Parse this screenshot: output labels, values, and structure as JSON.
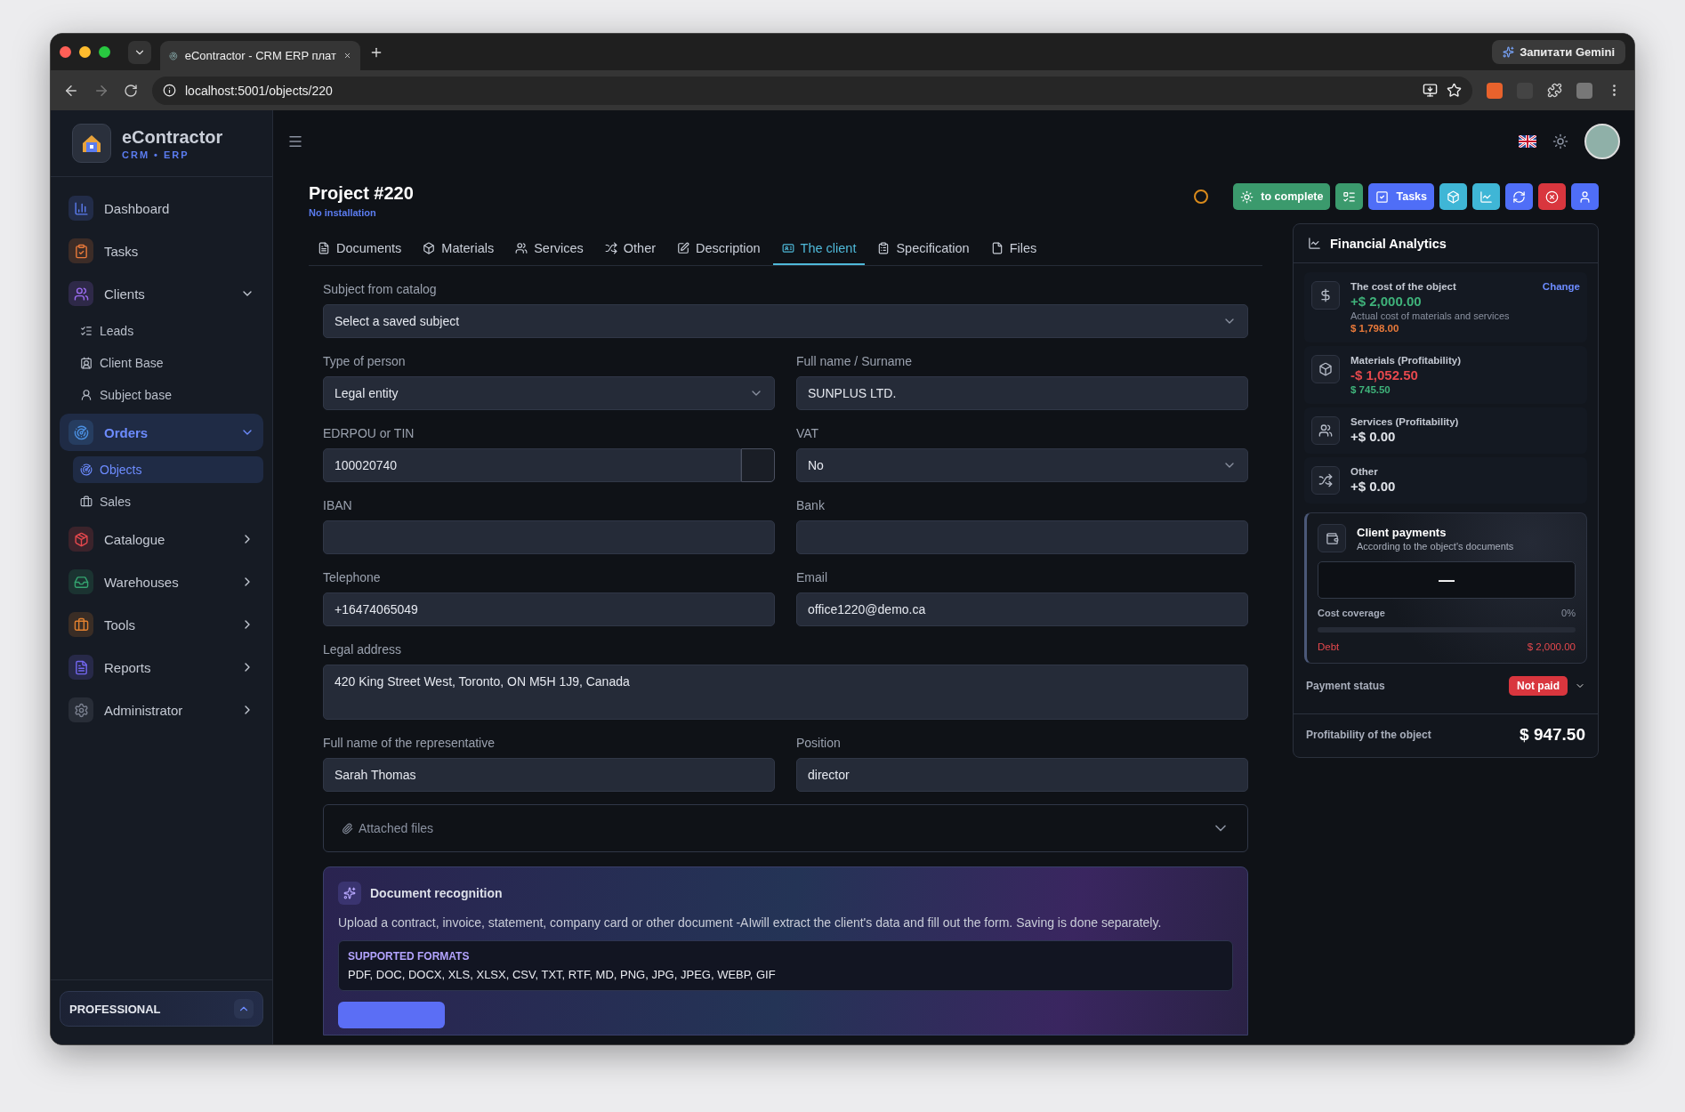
{
  "browser": {
    "tab_title": "eContractor - CRM ERP плат",
    "url": "localhost:5001/objects/220",
    "assistant_button": "Запитати Gemini"
  },
  "sidebar": {
    "brand": "eContractor",
    "brand_sub": "CRM • ERP",
    "items": [
      {
        "label": "Dashboard",
        "selected": false
      },
      {
        "label": "Tasks",
        "selected": false
      },
      {
        "label": "Clients",
        "selected": false,
        "expanded": true,
        "children": [
          {
            "label": "Leads",
            "selected": false
          },
          {
            "label": "Client Base",
            "selected": false
          },
          {
            "label": "Subject base",
            "selected": false
          }
        ]
      },
      {
        "label": "Orders",
        "selected": true,
        "expanded": true,
        "children": [
          {
            "label": "Objects",
            "selected": true
          },
          {
            "label": "Sales",
            "selected": false
          }
        ]
      },
      {
        "label": "Catalogue",
        "selected": false,
        "expanded": false
      },
      {
        "label": "Warehouses",
        "selected": false,
        "expanded": false
      },
      {
        "label": "Tools",
        "selected": false,
        "expanded": false
      },
      {
        "label": "Reports",
        "selected": false,
        "expanded": false
      },
      {
        "label": "Administrator",
        "selected": false,
        "expanded": false
      }
    ],
    "plan": "PROFESSIONAL"
  },
  "header": {
    "title": "Project #220",
    "subtitle": "No installation",
    "actions": [
      {
        "label": "to complete",
        "color": "#3b9a6d"
      },
      {
        "color": "#3b9a6d"
      },
      {
        "label": "Tasks",
        "color": "#4f6ef7"
      },
      {
        "color": "#3fb6d6"
      },
      {
        "color": "#3fb6d6"
      },
      {
        "color": "#4f6ef7"
      },
      {
        "color": "#d9363e"
      },
      {
        "color": "#4f6ef7"
      }
    ]
  },
  "tabs": [
    {
      "label": "Documents",
      "selected": false
    },
    {
      "label": "Materials",
      "selected": false
    },
    {
      "label": "Services",
      "selected": false
    },
    {
      "label": "Other",
      "selected": false
    },
    {
      "label": "Description",
      "selected": false
    },
    {
      "label": "The client",
      "selected": true
    },
    {
      "label": "Specification",
      "selected": false
    },
    {
      "label": "Files",
      "selected": false
    }
  ],
  "form": [
    [
      {
        "label": "Subject from catalog",
        "kind": "select",
        "value": "Select a saved subject"
      }
    ],
    [
      {
        "label": "Type of person",
        "kind": "select",
        "value": "Legal entity"
      },
      {
        "label": "Full name / Surname",
        "kind": "input",
        "value": "SUNPLUS LTD."
      }
    ],
    [
      {
        "label": "EDRPOU or TIN",
        "kind": "input_addon",
        "value": "100020740"
      },
      {
        "label": "VAT",
        "kind": "select",
        "value": "No"
      }
    ],
    [
      {
        "label": "IBAN",
        "kind": "input"
      },
      {
        "label": "Bank",
        "kind": "input"
      }
    ],
    [
      {
        "label": "Telephone",
        "kind": "input",
        "value": "+16474065049"
      },
      {
        "label": "Email",
        "kind": "input",
        "value": "office1220@demo.ca"
      }
    ],
    [
      {
        "label": "Legal address",
        "kind": "textarea",
        "value": "420 King Street West, Toronto, ON M5H 1J9, Canada"
      }
    ],
    [
      {
        "label": "Full name of the representative",
        "kind": "input",
        "value": "Sarah Thomas"
      },
      {
        "label": "Position",
        "kind": "input",
        "value": "director"
      }
    ]
  ],
  "attached_files": {
    "label": "Attached files",
    "expanded": false
  },
  "recognition": {
    "title": "Document recognition",
    "text": "Upload a contract, invoice, statement, company card or other document -AIwill extract the client's data and fill out the form. Saving is done separately.",
    "formats_title": "SUPPORTED FORMATS",
    "formats": "PDF, DOC, DOCX, XLS, XLSX, CSV, TXT, RTF, MD, PNG, JPG, JPEG, WEBP, GIF"
  },
  "analytics": {
    "title": "Financial Analytics",
    "items": [
      {
        "title": "The cost of the object",
        "value": "+$ 2,000.00",
        "color": "#3fb27a",
        "action": "Change",
        "note": "Actual cost of materials and services",
        "extra": {
          "text": "$ 1,798.00",
          "color": "#e8793a"
        }
      },
      {
        "title": "Materials (Profitability)",
        "value": "-$ 1,052.50",
        "color": "#e5484d",
        "extra": {
          "text": "$ 745.50",
          "color": "#3fb27a"
        }
      },
      {
        "title": "Services (Profitability)",
        "value": "+$ 0.00",
        "color": "#dfe2e8"
      },
      {
        "title": "Other",
        "value": "+$ 0.00",
        "color": "#dfe2e8"
      }
    ],
    "payments": {
      "title": "Client payments",
      "subtitle": "According to the object's documents",
      "amount": "—",
      "coverage_label": "Cost coverage",
      "coverage_value": "0%",
      "level": 0,
      "debt_label": "Debt",
      "debt": "$ 2,000.00"
    },
    "payment_status_label": "Payment status",
    "payment_status": "Not paid",
    "profit_label": "Profitability of the object",
    "profit": "$ 947.50"
  }
}
